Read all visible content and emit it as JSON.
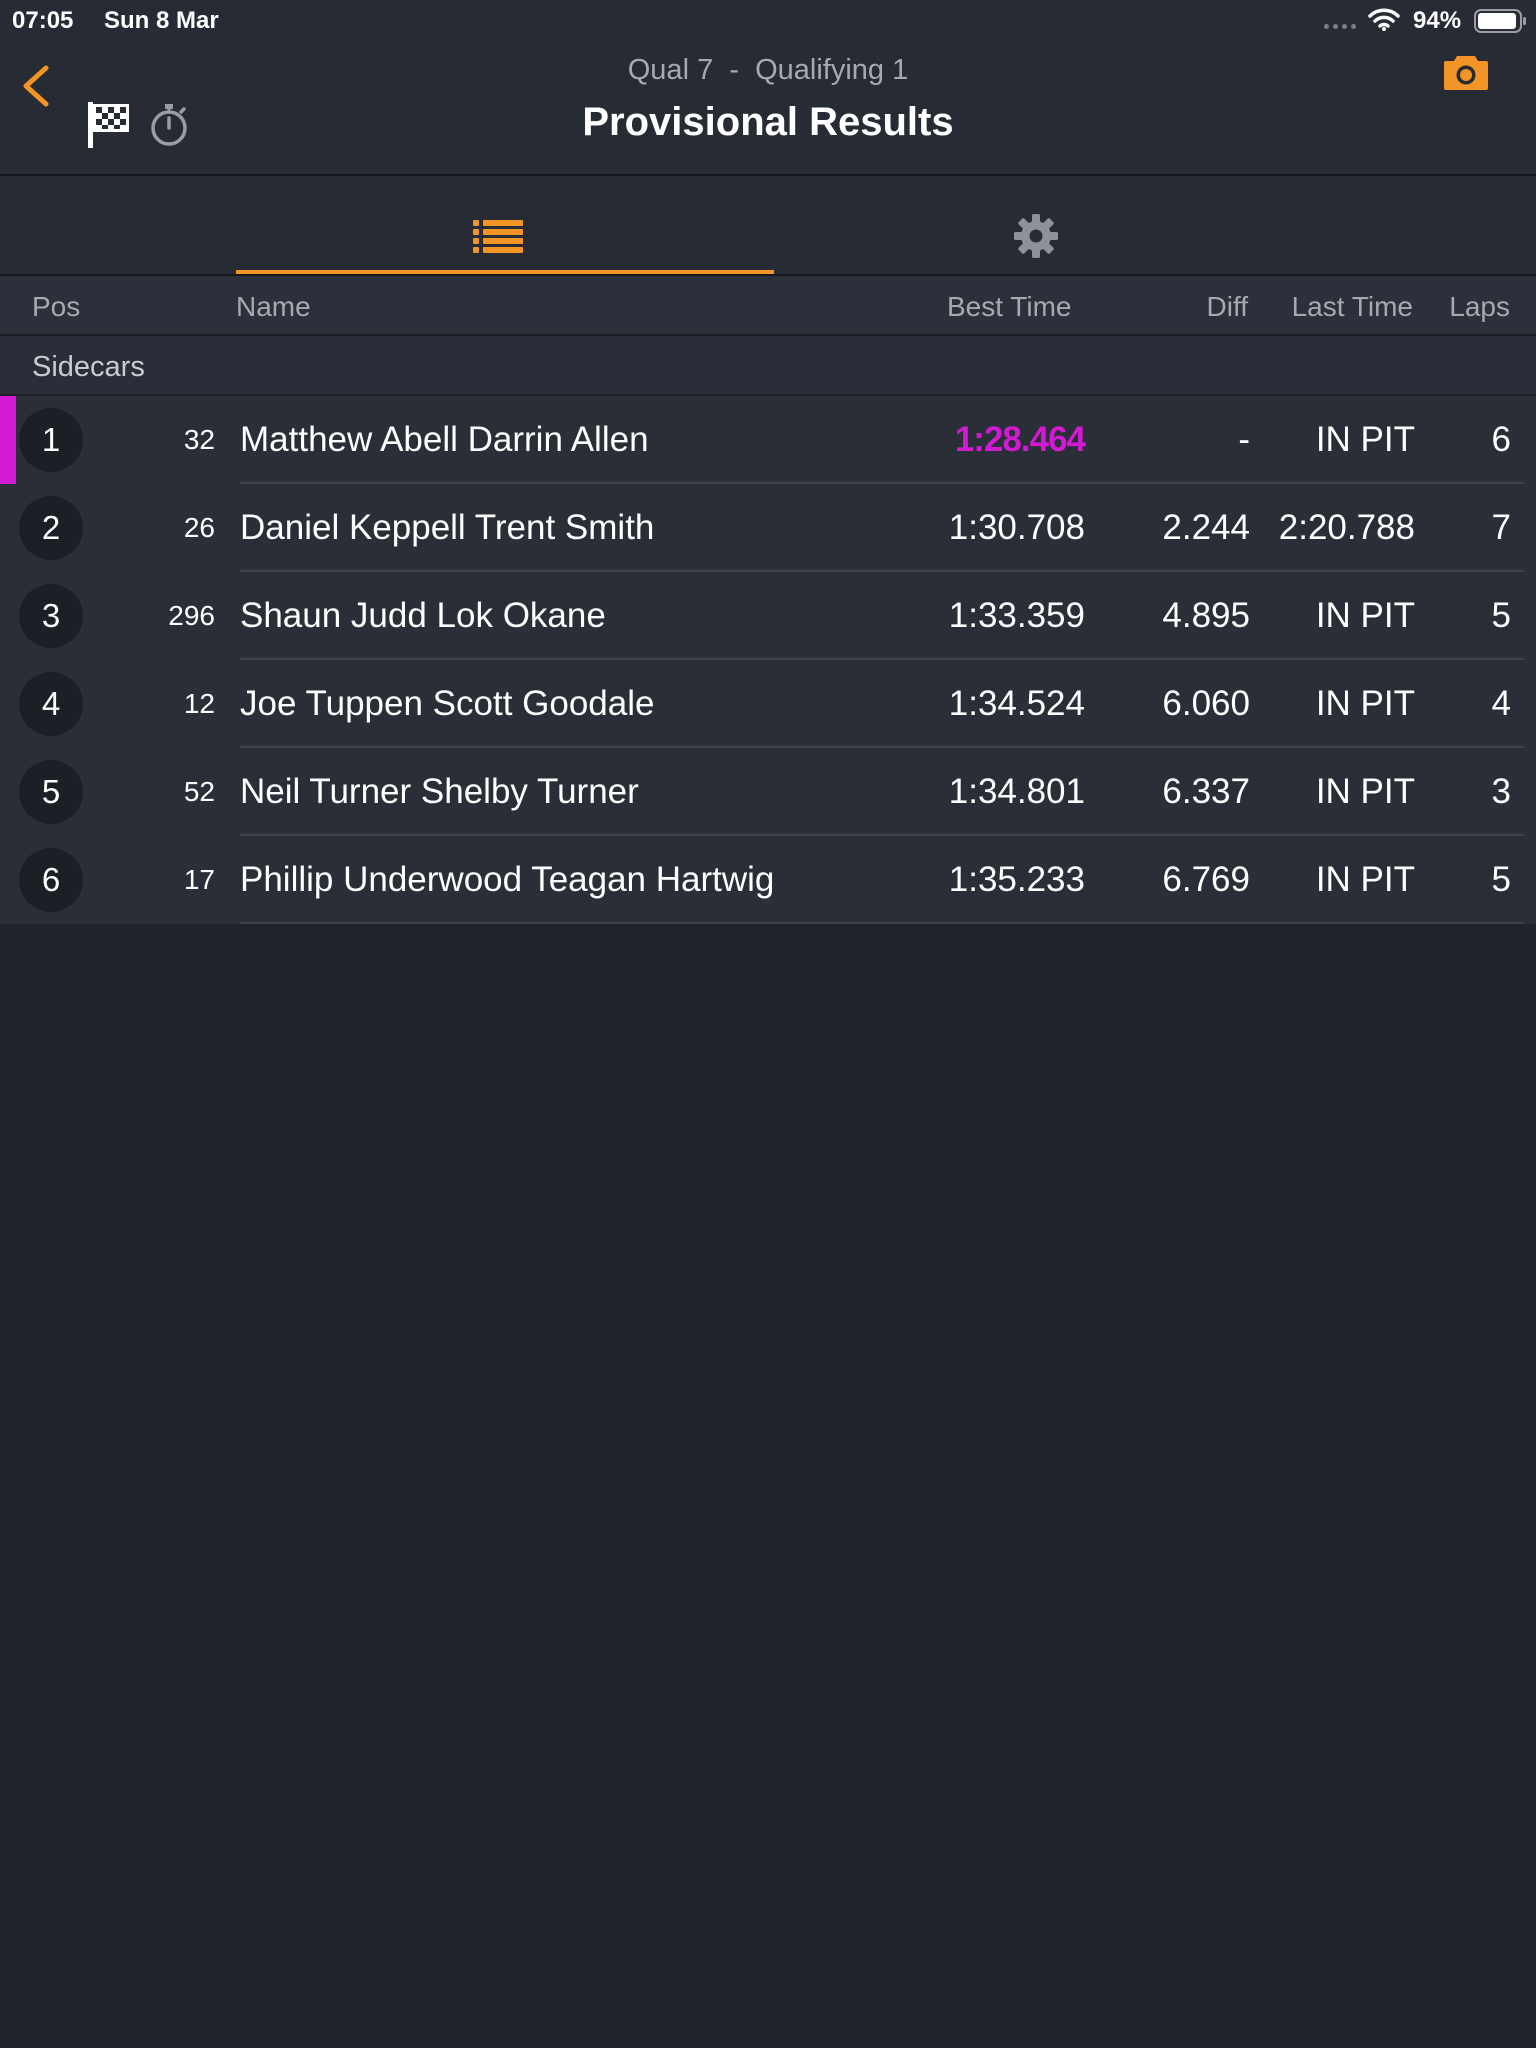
{
  "status_bar": {
    "time": "07:05",
    "date": "Sun 8 Mar",
    "battery": "94%"
  },
  "header": {
    "subtitle": "Qual 7  -  Qualifying 1",
    "title": "Provisional Results"
  },
  "icons": {
    "back": "chevron-left-icon",
    "flag": "checkered-flag-icon",
    "stopwatch": "stopwatch-icon",
    "camera": "camera-icon",
    "list_tab": "list-icon",
    "settings_tab": "gear-icon"
  },
  "colors": {
    "accent": "#f39426",
    "fastest": "#d21ad3",
    "background": "#20232c"
  },
  "columns": {
    "pos": "Pos",
    "name": "Name",
    "best_time": "Best Time",
    "diff": "Diff",
    "last_time": "Last Time",
    "laps": "Laps"
  },
  "group": "Sidecars",
  "rows": [
    {
      "pos": "1",
      "num": "32",
      "name": "Matthew Abell Darrin Allen",
      "best": "1:28.464",
      "diff": "-",
      "last": "IN PIT",
      "laps": "6"
    },
    {
      "pos": "2",
      "num": "26",
      "name": "Daniel Keppell Trent Smith",
      "best": "1:30.708",
      "diff": "2.244",
      "last": "2:20.788",
      "laps": "7"
    },
    {
      "pos": "3",
      "num": "296",
      "name": "Shaun Judd Lok Okane",
      "best": "1:33.359",
      "diff": "4.895",
      "last": "IN PIT",
      "laps": "5"
    },
    {
      "pos": "4",
      "num": "12",
      "name": "Joe Tuppen Scott Goodale",
      "best": "1:34.524",
      "diff": "6.060",
      "last": "IN PIT",
      "laps": "4"
    },
    {
      "pos": "5",
      "num": "52",
      "name": "Neil Turner Shelby Turner",
      "best": "1:34.801",
      "diff": "6.337",
      "last": "IN PIT",
      "laps": "3"
    },
    {
      "pos": "6",
      "num": "17",
      "name": "Phillip Underwood Teagan Hartwig",
      "best": "1:35.233",
      "diff": "6.769",
      "last": "IN PIT",
      "laps": "5"
    }
  ]
}
